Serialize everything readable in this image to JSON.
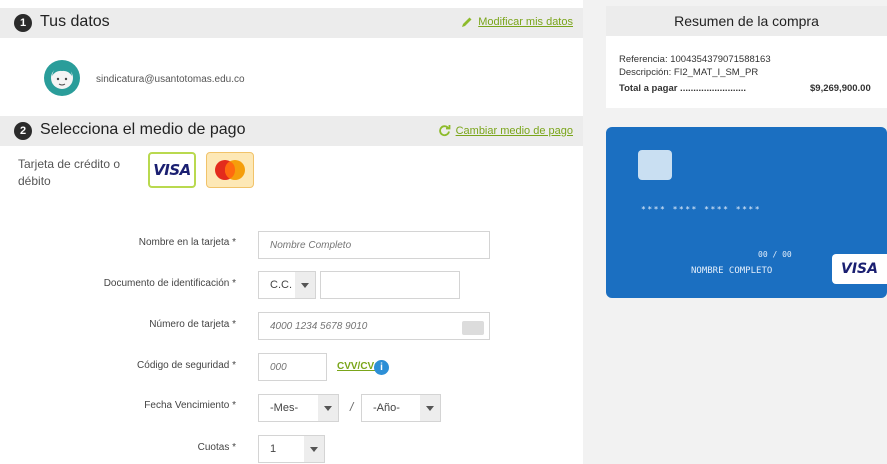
{
  "section1": {
    "number": "1",
    "title": "Tus datos",
    "action_label": "Modificar mis datos"
  },
  "user": {
    "email": "sindicatura@usantotomas.edu.co"
  },
  "section2": {
    "number": "2",
    "title": "Selecciona el medio de pago",
    "action_label": "Cambiar medio de pago"
  },
  "payment_method": {
    "label": "Tarjeta de crédito o débito",
    "visa_text": "VISA"
  },
  "form": {
    "name_label": "Nombre en la tarjeta *",
    "name_placeholder": "Nombre Completo",
    "doc_label": "Documento de identificación *",
    "doc_type_value": "C.C.",
    "card_number_label": "Número de tarjeta *",
    "card_number_placeholder": "4000 1234 5678 9010",
    "cvv_label": "Código de seguridad *",
    "cvv_placeholder": "000",
    "cvv_link": "CVV/CVC",
    "info_glyph": "i",
    "expiry_label": "Fecha Vencimiento *",
    "month_value": "-Mes-",
    "separator": "/",
    "year_value": "-Año-",
    "installments_label": "Cuotas *",
    "installments_value": "1"
  },
  "summary": {
    "title": "Resumen de la compra",
    "reference": "Referencia: 1004354379071588163",
    "description": "Descripción: FI2_MAT_I_SM_PR",
    "total_label": "Total a pagar .........................",
    "total_amount": "$9,269,900.00"
  },
  "card_preview": {
    "number": "**** **** **** ****",
    "expiry": "00 / 00",
    "holder": "NOMBRE COMPLETO",
    "brand": "VISA",
    "color": "#1b6fc1"
  },
  "colors": {
    "accent_green": "#7aa51a",
    "info_blue": "#2d8fd6"
  }
}
